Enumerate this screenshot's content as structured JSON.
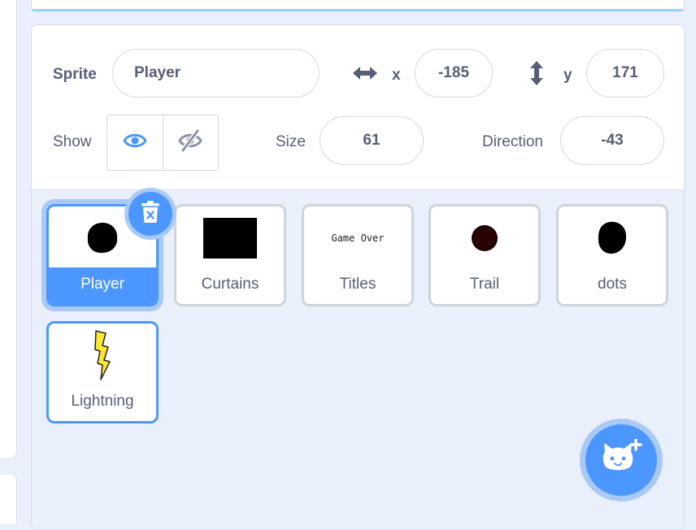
{
  "colors": {
    "accent": "#4c97ff",
    "accent_glow": "#a9c9f7",
    "text": "#575e75",
    "panel_bg": "#e9f0fb"
  },
  "sprite_info": {
    "sprite_label": "Sprite",
    "sprite_name": "Player",
    "x_label": "x",
    "x_value": "-185",
    "y_label": "y",
    "y_value": "171",
    "show_label": "Show",
    "size_label": "Size",
    "size_value": "61",
    "direction_label": "Direction",
    "direction_value": "-43",
    "show_visible_selected": true
  },
  "sprites": [
    {
      "name": "Player",
      "selected": true,
      "thumb": "black-blob"
    },
    {
      "name": "Curtains",
      "selected": false,
      "thumb": "black-rect"
    },
    {
      "name": "Titles",
      "selected": false,
      "thumb": "text",
      "thumb_text": "Game Over"
    },
    {
      "name": "Trail",
      "selected": false,
      "thumb": "dark-red-dot"
    },
    {
      "name": "dots",
      "selected": false,
      "thumb": "black-oval"
    },
    {
      "name": "Lightning",
      "selected": false,
      "thumb": "lightning-bolt"
    }
  ],
  "icons": {
    "delete": "trash-icon",
    "add_sprite": "cat-plus-icon",
    "x_arrow": "horizontal-arrow-icon",
    "y_arrow": "vertical-arrow-icon",
    "show": "eye-icon",
    "hide": "eye-slash-icon"
  }
}
